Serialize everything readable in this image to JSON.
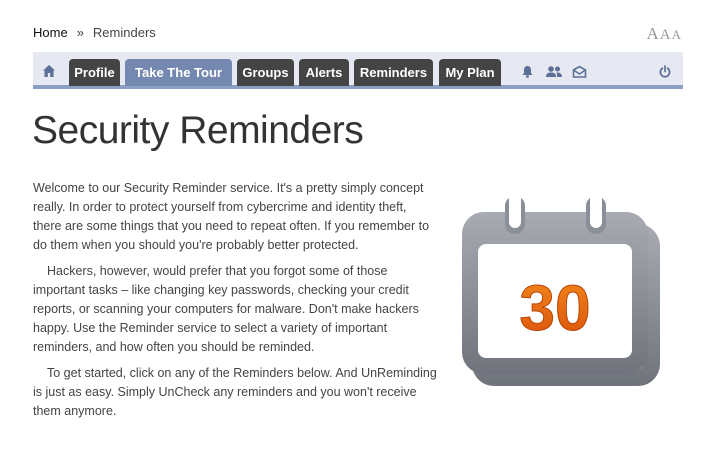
{
  "breadcrumb": {
    "home": "Home",
    "separator": "»",
    "current": "Reminders"
  },
  "text_size": {
    "large": "A",
    "medium": "A",
    "small": "A"
  },
  "nav": {
    "tabs": [
      {
        "label": "Profile",
        "active": false
      },
      {
        "label": "Take The Tour",
        "active": true
      },
      {
        "label": "Groups",
        "active": false
      },
      {
        "label": "Alerts",
        "active": false
      },
      {
        "label": "Reminders",
        "active": false
      },
      {
        "label": "My Plan",
        "active": false
      }
    ],
    "icons": [
      "home-icon",
      "bell-icon",
      "users-icon",
      "envelope-icon",
      "power-icon"
    ]
  },
  "page": {
    "title": "Security Reminders",
    "paragraphs": [
      "Welcome to our Security Reminder service. It's a pretty simply concept really. In order to protect yourself from cybercrime and identity theft, there are some things that you need to repeat often. If you remember to do them when you should you're probably better protected.",
      "Hackers, however, would prefer that you forgot some of those important tasks – like changing key passwords, checking your credit reports, or scanning your computers for malware. Don't make hackers happy. Use the Reminder service to select a variety of important reminders, and how often you should be reminded.",
      "To get started, click on any of the Reminders below. And UnReminding is just as easy. Simply UnCheck any reminders and you won't receive them anymore."
    ]
  },
  "calendar": {
    "day": "30",
    "accent": "#e8620f",
    "frame": "#8e9199"
  }
}
